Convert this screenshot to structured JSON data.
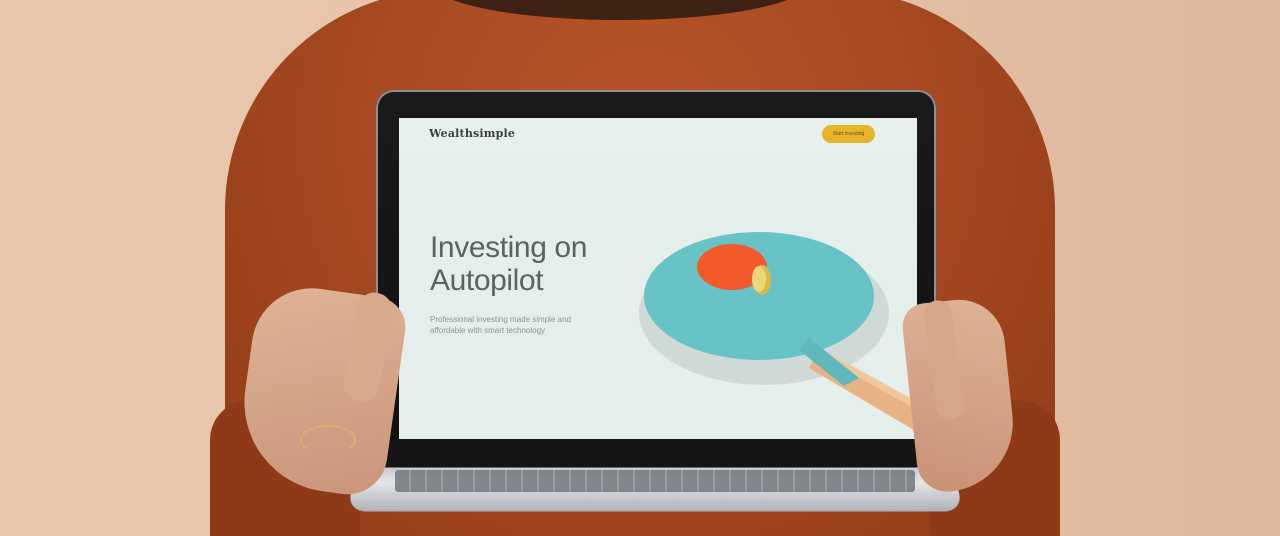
{
  "site": {
    "brand": "Wealthsimple",
    "cta_label": "Start investing",
    "headline_line1": "Investing on",
    "headline_line2": "Autopilot",
    "subtext": "Professional investing made simple and affordable with smart technology"
  },
  "colors": {
    "background": "#e8c7ad",
    "sweater": "#a84a22",
    "screen": "#e4eeeb",
    "cta": "#e7b32b",
    "paddle": "#68c3c6",
    "paddle_spot": "#f25a2c"
  },
  "icons": [
    "ping-pong-paddle-illustration",
    "coin-illustration"
  ]
}
